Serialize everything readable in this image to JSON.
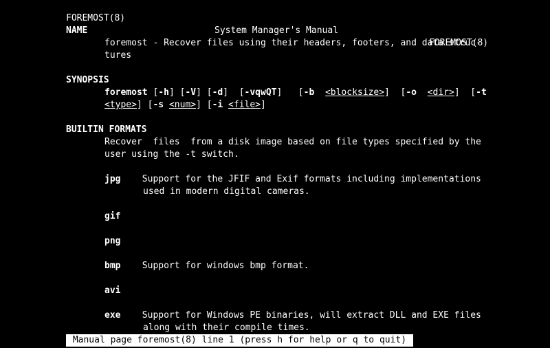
{
  "header": {
    "left": "FOREMOST(8)",
    "center": "System Manager's Manual",
    "right": "FOREMOST(8)"
  },
  "sections": {
    "name_hdr": "NAME",
    "name_l1": "foremost - Recover files using their headers, footers, and data struc-",
    "name_l2": "tures",
    "syn_hdr": "SYNOPSIS",
    "syn_cmd": "foremost",
    "syn_flags": {
      "h": "-h",
      "V": "-V",
      "d": "-d",
      "vqwQT": "-vqwQT",
      "b": "-b",
      "o": "-o",
      "t": "-t",
      "s": "-s",
      "i": "-i"
    },
    "syn_args": {
      "blocksize": "<blocksize>",
      "dir": "<dir>",
      "type": "<type>",
      "num": "<num>",
      "file": "<file>"
    },
    "bi_hdr": "BUILTIN FORMATS",
    "bi_l1": "Recover  files  from a disk image based on file types specified by the",
    "bi_l2": "user using the -t switch.",
    "fmt_jpg": "jpg",
    "jpg_l1": "Support for the JFIF and Exif formats including implementations",
    "jpg_l2": "used in modern digital cameras.",
    "fmt_gif": "gif",
    "fmt_png": "png",
    "fmt_bmp": "bmp",
    "bmp_l1": "Support for windows bmp format.",
    "fmt_avi": "avi",
    "fmt_exe": "exe",
    "exe_l1": "Support for Windows PE binaries, will extract DLL and EXE files",
    "exe_l2": "along with their compile times."
  },
  "status_bar": " Manual page foremost(8) line 1 (press h for help or q to quit) "
}
